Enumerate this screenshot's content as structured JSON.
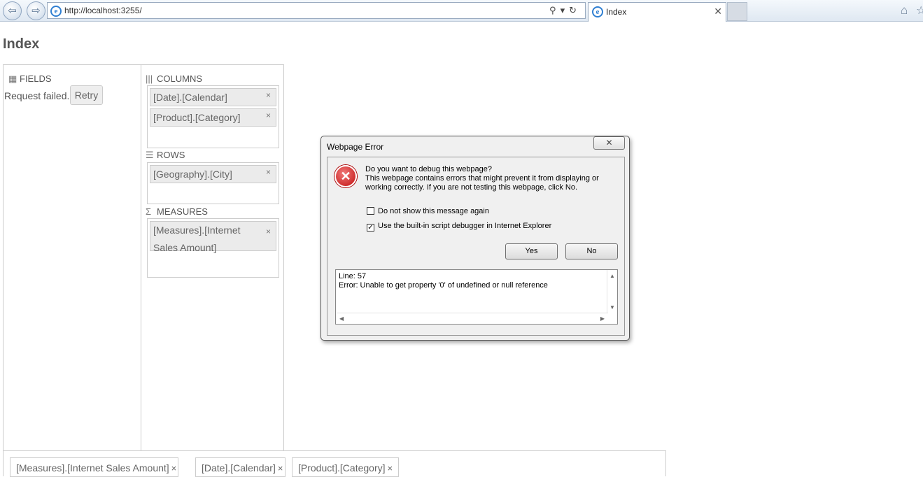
{
  "browser": {
    "url": "http://localhost:3255/",
    "tab_title": "Index",
    "tab_close": "✕",
    "address_icons": "⚲▾↻"
  },
  "page": {
    "title": "Index"
  },
  "pivot": {
    "fields_label": "FIELDS",
    "request_failed": "Request failed.",
    "retry_label": "Retry",
    "columns_label": "COLUMNS",
    "columns": [
      "[Date].[Calendar]",
      "[Product].[Category]"
    ],
    "rows_label": "ROWS",
    "rows": [
      "[Geography].[City]"
    ],
    "measures_label": "MEASURES",
    "measures": [
      "[Measures].[Internet Sales Amount]"
    ],
    "remove_glyph": "×"
  },
  "bottom_bar": {
    "items": [
      "[Measures].[Internet Sales Amount]",
      "[Date].[Calendar]",
      "[Product].[Category]"
    ]
  },
  "dialog": {
    "title": "Webpage Error",
    "close_glyph": "✕",
    "message_heading": "Do you want to debug this webpage?",
    "message_body": "This webpage contains errors that might prevent it from displaying or working correctly. If you are not testing this webpage, click No.",
    "checkbox_dont_show": "Do not show this message again",
    "checkbox_dont_show_checked": false,
    "checkbox_debugger": "Use the built-in script debugger in Internet Explorer",
    "checkbox_debugger_checked": true,
    "yes_label": "Yes",
    "no_label": "No",
    "error_line": "Line: 57",
    "error_text": "Error: Unable to get property '0' of undefined or null reference"
  }
}
